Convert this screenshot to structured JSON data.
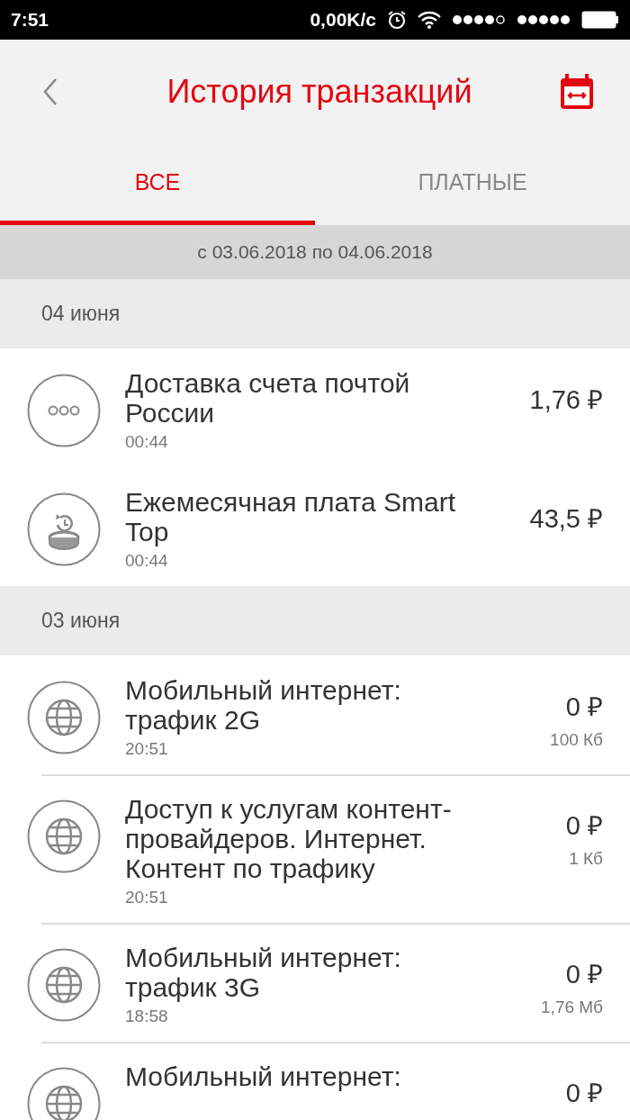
{
  "status_bar": {
    "time": "7:51",
    "speed": "0,00K/c"
  },
  "header": {
    "title": "История транзакций"
  },
  "tabs": [
    {
      "label": "ВСЕ",
      "selected": true
    },
    {
      "label": "ПЛАТНЫЕ",
      "selected": false
    }
  ],
  "period": "с 03.06.2018 по 04.06.2018",
  "sections": [
    {
      "date": "04 июня",
      "items": [
        {
          "kind": "more",
          "title": "Доставка счета почтой России",
          "time": "00:44",
          "amount": "1,76 ₽"
        },
        {
          "kind": "subscription",
          "title": "Ежемесячная плата Smart Top",
          "time": "00:44",
          "amount": "43,5 ₽"
        }
      ]
    },
    {
      "date": "03 июня",
      "items": [
        {
          "kind": "globe",
          "title": "Мобильный интернет: трафик 2G",
          "time": "20:51",
          "amount": "0 ₽",
          "volume": "100 Кб"
        },
        {
          "kind": "globe",
          "title": "Доступ к услугам контент-провайдеров. Интернет. Контент по трафику",
          "time": "20:51",
          "amount": "0 ₽",
          "volume": "1 Кб"
        },
        {
          "kind": "globe",
          "title": "Мобильный интернет: трафик 3G",
          "time": "18:58",
          "amount": "0 ₽",
          "volume": "1,76 Мб"
        },
        {
          "kind": "globe",
          "title": "Мобильный интернет:",
          "amount": "0 ₽"
        }
      ]
    }
  ]
}
